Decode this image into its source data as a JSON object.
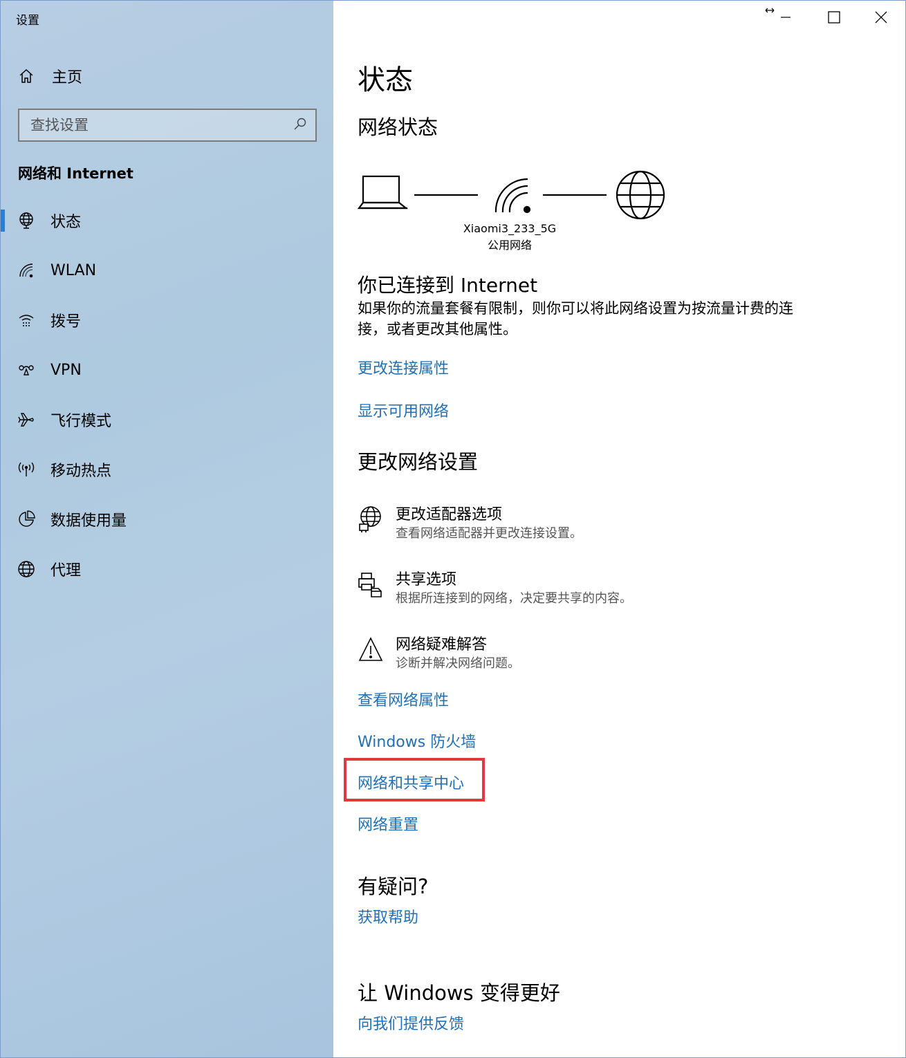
{
  "window": {
    "title": "设置"
  },
  "sidebar": {
    "home_label": "主页",
    "search_placeholder": "查找设置",
    "section": "网络和 Internet",
    "items": [
      {
        "label": "状态",
        "icon": "globe-monitor-icon",
        "active": true
      },
      {
        "label": "WLAN",
        "icon": "wifi-icon"
      },
      {
        "label": "拨号",
        "icon": "dialup-icon"
      },
      {
        "label": "VPN",
        "icon": "vpn-icon"
      },
      {
        "label": "飞行模式",
        "icon": "airplane-icon"
      },
      {
        "label": "移动热点",
        "icon": "hotspot-icon"
      },
      {
        "label": "数据使用量",
        "icon": "pie-chart-icon"
      },
      {
        "label": "代理",
        "icon": "globe-icon"
      }
    ]
  },
  "main": {
    "title": "状态",
    "network_status_heading": "网络状态",
    "network": {
      "ssid": "Xiaomi3_233_5G",
      "type": "公用网络"
    },
    "connected_title": "你已连接到 Internet",
    "connected_desc": "如果你的流量套餐有限制，则你可以将此网络设置为按流量计费的连接，或者更改其他属性。",
    "links_top": [
      "更改连接属性",
      "显示可用网络"
    ],
    "change_heading": "更改网络设置",
    "options": [
      {
        "title": "更改适配器选项",
        "desc": "查看网络适配器并更改连接设置。",
        "icon": "adapter-icon"
      },
      {
        "title": "共享选项",
        "desc": "根据所连接到的网络，决定要共享的内容。",
        "icon": "sharing-icon"
      },
      {
        "title": "网络疑难解答",
        "desc": "诊断并解决网络问题。",
        "icon": "warning-icon"
      }
    ],
    "links_bottom": [
      "查看网络属性",
      "Windows 防火墙",
      "网络和共享中心",
      "网络重置"
    ],
    "question_heading": "有疑问?",
    "help_link": "获取帮助",
    "feedback_heading": "让 Windows 变得更好",
    "feedback_link": "向我们提供反馈"
  },
  "colors": {
    "accent": "#2a7fd4",
    "link": "#1f70b8",
    "highlight": "#e0393e"
  }
}
